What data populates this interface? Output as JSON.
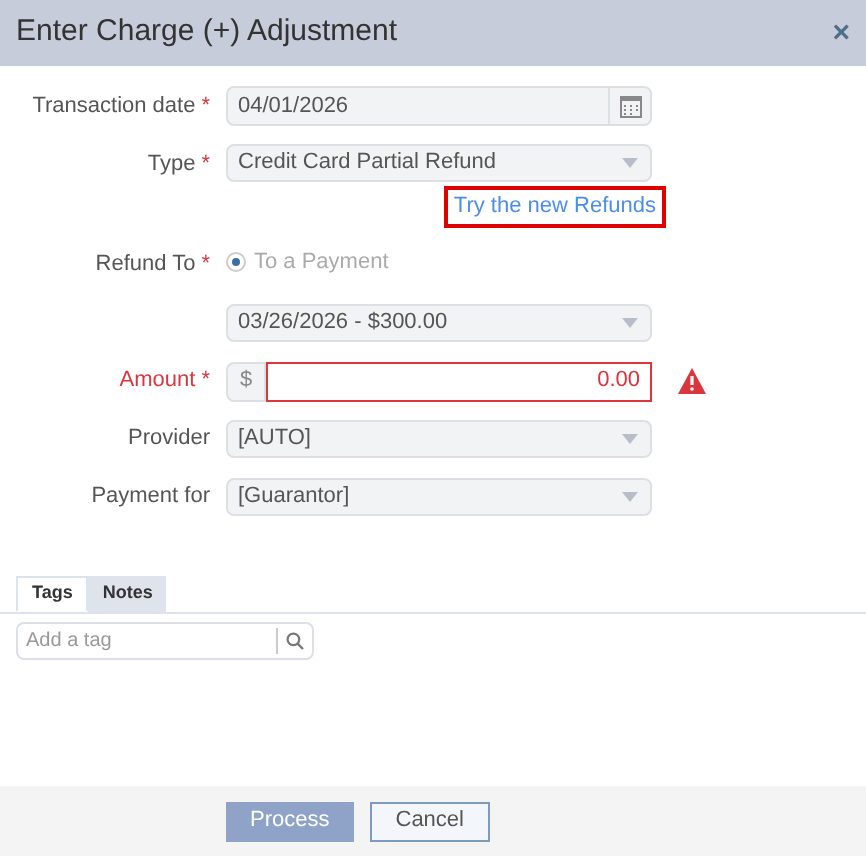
{
  "dialog": {
    "title": "Enter Charge (+) Adjustment",
    "close": "×"
  },
  "fields": [
    {
      "kind": "date",
      "label": "Transaction date",
      "required_mark": "*",
      "value": "04/01/2026"
    },
    {
      "kind": "select",
      "label": "Type",
      "required_mark": "*",
      "value": "Credit Card Partial Refund",
      "link": {
        "text": "Try the new Refunds",
        "highlighted": true
      }
    },
    {
      "kind": "radio",
      "label": "Refund To",
      "required_mark": "*",
      "option": "To a Payment",
      "selected": true
    },
    {
      "kind": "select",
      "value": "03/26/2026 - $300.00"
    },
    {
      "kind": "amount",
      "label": "Amount",
      "required_mark": "*",
      "error": true,
      "prefix": "$",
      "value": "0.00"
    },
    {
      "kind": "select",
      "label": "Provider",
      "value": "[AUTO]"
    },
    {
      "kind": "select",
      "label": "Payment for",
      "value": "[Guarantor]"
    }
  ],
  "tabs": [
    {
      "label": "Tags",
      "selected": true
    },
    {
      "label": "Notes",
      "selected": false
    }
  ],
  "tag_field": {
    "placeholder": "Add a tag"
  },
  "buttons": [
    {
      "label": "Process",
      "kind": "primary"
    },
    {
      "label": "Cancel",
      "kind": "secondary"
    }
  ]
}
